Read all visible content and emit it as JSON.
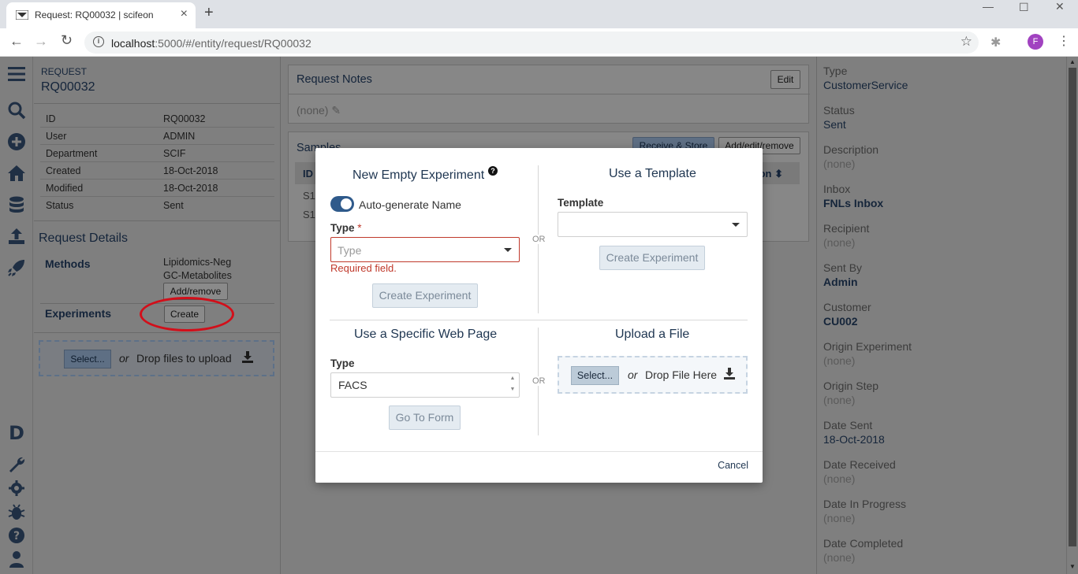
{
  "browser": {
    "tab_title": "Request: RQ00032 | scifeon",
    "url_host": "localhost",
    "url_rest": ":5000/#/entity/request/RQ00032",
    "profile_initial": "F"
  },
  "left_panel": {
    "label": "REQUEST",
    "id_title": "RQ00032",
    "properties": [
      {
        "key": "ID",
        "value": "RQ00032"
      },
      {
        "key": "User",
        "value": "ADMIN"
      },
      {
        "key": "Department",
        "value": "SCIF"
      },
      {
        "key": "Created",
        "value": "18-Oct-2018"
      },
      {
        "key": "Modified",
        "value": "18-Oct-2018"
      },
      {
        "key": "Status",
        "value": "Sent"
      }
    ],
    "details_title": "Request Details",
    "methods_label": "Methods",
    "methods": [
      "Lipidomics-Neg",
      "GC-Metabolites"
    ],
    "add_remove_label": "Add/remove",
    "experiments_label": "Experiments",
    "create_label": "Create",
    "upload": {
      "select_label": "Select...",
      "or": "or",
      "text": "Drop files to upload"
    }
  },
  "center": {
    "notes_title": "Request Notes",
    "edit_label": "Edit",
    "notes_value": "(none)",
    "samples_title": "Samples",
    "receive_store_label": "Receive & Store",
    "add_edit_remove_label": "Add/edit/remove",
    "col_id": "ID",
    "col_right": "ion",
    "rows": [
      "S1",
      "S1"
    ]
  },
  "right_panel": {
    "fields": [
      {
        "key": "Type",
        "value": "CustomerService",
        "style": "plain"
      },
      {
        "key": "Status",
        "value": "Sent",
        "style": "plain"
      },
      {
        "key": "Description",
        "value": "(none)",
        "style": "none"
      },
      {
        "key": "Inbox",
        "value": "FNLs Inbox",
        "style": "link"
      },
      {
        "key": "Recipient",
        "value": "(none)",
        "style": "none"
      },
      {
        "key": "Sent By",
        "value": "Admin",
        "style": "link"
      },
      {
        "key": "Customer",
        "value": "CU002",
        "style": "link"
      },
      {
        "key": "Origin Experiment",
        "value": "(none)",
        "style": "none"
      },
      {
        "key": "Origin Step",
        "value": "(none)",
        "style": "none"
      },
      {
        "key": "Date Sent",
        "value": "18-Oct-2018",
        "style": "plain"
      },
      {
        "key": "Date Received",
        "value": "(none)",
        "style": "none"
      },
      {
        "key": "Date In Progress",
        "value": "(none)",
        "style": "none"
      },
      {
        "key": "Date Completed",
        "value": "(none)",
        "style": "none"
      }
    ]
  },
  "modal": {
    "empty_title": "New Empty Experiment",
    "auto_name_label": "Auto-generate Name",
    "auto_name_on": true,
    "type_label": "Type",
    "required_star": "*",
    "type_placeholder": "Type",
    "required_error": "Required field.",
    "create_experiment_label": "Create Experiment",
    "or_label": "OR",
    "template_title": "Use a Template",
    "template_label": "Template",
    "template_value": "",
    "template_create_label": "Create Experiment",
    "webpage_title": "Use a Specific Web Page",
    "webpage_type_label": "Type",
    "webpage_type_value": "FACS",
    "go_to_form_label": "Go To Form",
    "upload_title": "Upload a File",
    "upload_select_label": "Select...",
    "upload_or": "or",
    "upload_text": "Drop File Here",
    "cancel_label": "Cancel"
  },
  "colors": {
    "overlay": "#7f7f7f",
    "primary": "#1f3651",
    "toggle": "#2f5a8b",
    "error": "#c0392b",
    "annotation": "#d20f1a"
  }
}
